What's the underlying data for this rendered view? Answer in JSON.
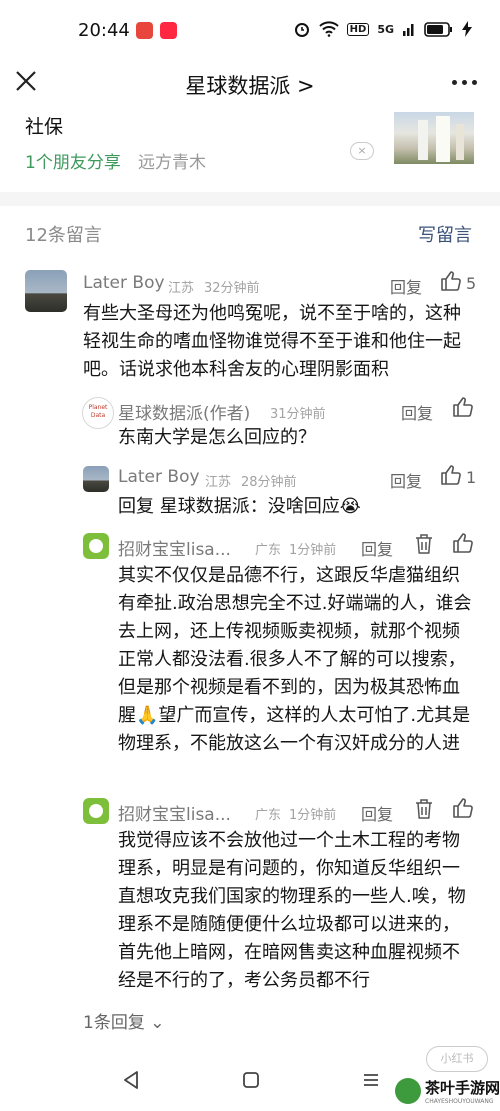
{
  "status_bar": {
    "time": "20:44",
    "net": "5G",
    "battery": "80%"
  },
  "nav": {
    "title": "星球数据派 >"
  },
  "shared_article": {
    "title": "社保",
    "friends": "1个朋友分享",
    "author": "远方青木",
    "dismiss": "×"
  },
  "comments_header": {
    "count": "12条留言",
    "write": "写留言"
  },
  "comments": [
    {
      "name": "Later Boy",
      "region": "江苏",
      "time": "32分钟前",
      "reply": "回复",
      "likes": "5",
      "text": "有些大圣母还为他鸣冤呢，说不至于啥的，这种轻视生命的嗜血怪物谁觉得不至于谁和他住一起吧。话说求他本科舍友的心理阴影面积"
    },
    {
      "name": "星球数据派(作者)",
      "time": "31分钟前",
      "reply": "回复",
      "text": "东南大学是怎么回应的？",
      "avatar_text": [
        "Planet",
        "Data"
      ]
    },
    {
      "name": "Later Boy",
      "region": "江苏",
      "time": "28分钟前",
      "reply": "回复",
      "likes": "1",
      "text": "回复 星球数据派：没啥回应😭"
    },
    {
      "name": "招财宝宝lisa...",
      "region": "广东",
      "time": "1分钟前",
      "reply": "回复",
      "text": "其实不仅仅是品德不行，这跟反华虐猫组织有牵扯.政治思想完全不过.好端端的人，谁会去上网，还上传视频贩卖视频，就那个视频正常人都没法看.很多人不了解的可以搜索，但是那个视频是看不到的，因为极其恐怖血腥🙏望广而宣传，这样的人太可怕了.尤其是物理系，不能放这么一个有汉奸成分的人进"
    },
    {
      "name": "招财宝宝lisa...",
      "region": "广东",
      "time": "1分钟前",
      "reply": "回复",
      "text": "我觉得应该不会放他过一个土木工程的考物理系，明显是有问题的，你知道反华组织一直想攻克我们国家的物理系的一些人.唉，物理系不是随随便便什么垃圾都可以进来的，首先他上暗网，在暗网售卖这种血腥视频不经是不行的了，考公务员都不行"
    }
  ],
  "more_replies": "1条回复 ⌄",
  "watermark": "小红书",
  "logo": {
    "text": "茶叶手游网",
    "sub": "CHAYESHOUYOUWANG"
  },
  "colors": {
    "green": "#3d9a5c",
    "link": "#3a5278",
    "gray": "#8a8a8a",
    "appRed": "#e8453c"
  }
}
